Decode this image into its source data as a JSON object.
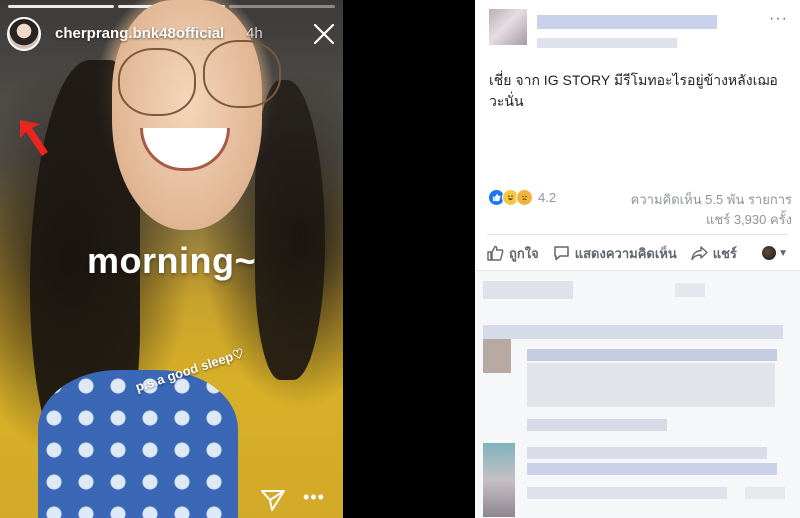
{
  "story": {
    "username": "cherprang.bnk48official",
    "time_ago": "4h",
    "caption_main": "morning~",
    "caption_sub": "p.s.a good sleep♡",
    "icons": {
      "close": "close-icon",
      "annotation_arrow": "arrow-icon",
      "send": "send-icon",
      "more": "more-icon"
    },
    "colors": {
      "annotation_arrow": "#e8251e"
    }
  },
  "facebook_post": {
    "post_text": "เชี่ย จาก IG STORY มีรีโมทอะไรอยู่ข้างหลังเฌอ วะนั่น",
    "reactions": {
      "count": "4.2"
    },
    "comments_count": "ความคิดเห็น 5.5 พัน รายการ",
    "shares_count": "แชร์ 3,930 ครั้ง",
    "actions": {
      "like": "ถูกใจ",
      "comment": "แสดงความคิดเห็น",
      "share": "แชร์"
    },
    "more_label": "···",
    "colors": {
      "like_blue": "#1877f2"
    }
  }
}
